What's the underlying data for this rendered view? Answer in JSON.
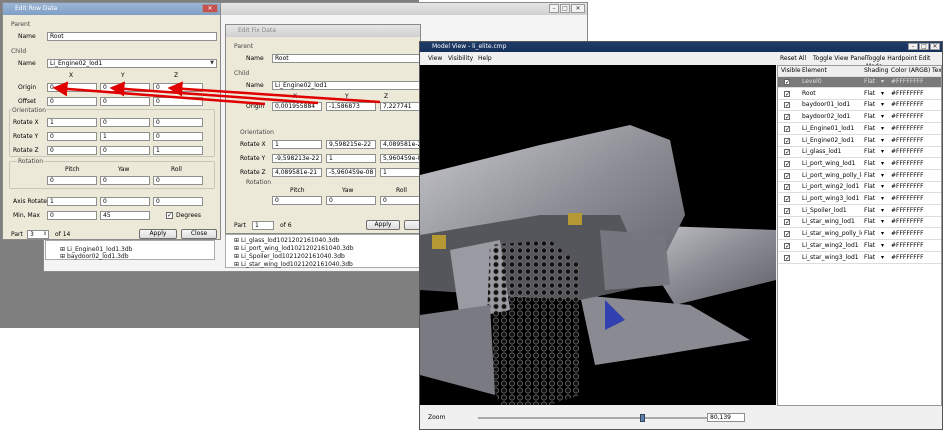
{
  "edit_row_dialog": {
    "title": "Edit Row Data",
    "parent_section": "Parent",
    "parent_name_label": "Name",
    "parent_name_value": "Root",
    "child_section": "Child",
    "child_name_label": "Name",
    "child_name_value": "Li_Engine02_lod1",
    "col_x": "X",
    "col_y": "Y",
    "col_z": "Z",
    "origin_label": "Origin",
    "origin": [
      "0",
      "0",
      "0"
    ],
    "offset_label": "Offset",
    "offset": [
      "0",
      "0",
      "0"
    ],
    "orientation_section": "Orientation",
    "rotate_x_label": "Rotate X",
    "rotate_x": [
      "1",
      "0",
      "0"
    ],
    "rotate_y_label": "Rotate Y",
    "rotate_y": [
      "0",
      "1",
      "0"
    ],
    "rotate_z_label": "Rotate Z",
    "rotate_z": [
      "0",
      "0",
      "1"
    ],
    "rotation_section": "Rotation",
    "pitch_label": "Pitch",
    "yaw_label": "Yaw",
    "roll_label": "Roll",
    "rotation": [
      "0",
      "0",
      "0"
    ],
    "axis_rotate_label": "Axis Rotate",
    "axis_rotate": [
      "1",
      "0",
      "0"
    ],
    "min_max_label": "Min, Max",
    "min_max": [
      "0",
      "45"
    ],
    "degrees_label": "Degrees",
    "part_label": "Part",
    "part_value": "3",
    "part_of": "of 14",
    "apply_label": "Apply",
    "close_label": "Close"
  },
  "fix_dialog": {
    "title": "Edit Fix Data",
    "parent_section": "Parent",
    "parent_name_label": "Name",
    "parent_name_value": "Root",
    "child_section": "Child",
    "child_name_label": "Name",
    "child_name_value": "Li_Engine02_lod1",
    "col_x": "X",
    "col_y": "Y",
    "col_z": "Z",
    "origin_label": "Origin",
    "origin": [
      "0,001955884",
      "-1,586873",
      "7,227741"
    ],
    "orientation_section": "Orientation",
    "rotate_x_label": "Rotate X",
    "rotate_x": [
      "1",
      "9,598215e-22",
      "4,089581e-21"
    ],
    "rotate_y_label": "Rotate Y",
    "rotate_y": [
      "-9,598213e-22",
      "1",
      "5,960459e-08"
    ],
    "rotate_z_label": "Rotate Z",
    "rotate_z": [
      "4,089581e-21",
      "-5,960459e-08",
      "1"
    ],
    "rotation_section": "Rotation",
    "pitch_label": "Pitch",
    "yaw_label": "Yaw",
    "roll_label": "Roll",
    "rotation": [
      "0",
      "0",
      "0"
    ],
    "part_label": "Part",
    "part_value": "1",
    "part_of": "of 6",
    "apply_label": "Apply"
  },
  "back_tree": {
    "left_items": [
      "Li_Engine01_lod1.3db",
      "baydoor02_lod1.3db"
    ],
    "right_items": [
      "Li_glass_lod1021202161040.3db",
      "Li_port_wing_lod1021202161040.3db",
      "Li_Spoiler_lod1021202161040.3db",
      "Li_star_wing_lod1021202161040.3db"
    ]
  },
  "model_view": {
    "title": "Model View - li_elite.cmp",
    "menu": [
      "View",
      "Visibility",
      "Help"
    ],
    "toolbar": [
      "Reset All",
      "Toggle View Panel",
      "Toggle Hardpoint Edit Mode"
    ],
    "columns": [
      "Visible",
      "Element",
      "Shading",
      "Color (ARGB)",
      "Tex"
    ],
    "rows": [
      {
        "element": "Level0",
        "shading": "Flat",
        "color": "#FFFFFFFF",
        "checked": true,
        "selected": true
      },
      {
        "element": "Root",
        "shading": "Flat",
        "color": "#FFFFFFFF",
        "checked": true
      },
      {
        "element": "baydoor01_lod1",
        "shading": "Flat",
        "color": "#FFFFFFFF",
        "checked": true
      },
      {
        "element": "baydoor02_lod1",
        "shading": "Flat",
        "color": "#FFFFFFFF",
        "checked": true
      },
      {
        "element": "Li_Engine01_lod1",
        "shading": "Flat",
        "color": "#FFFFFFFF",
        "checked": true
      },
      {
        "element": "Li_Engine02_lod1",
        "shading": "Flat",
        "color": "#FFFFFFFF",
        "checked": true
      },
      {
        "element": "Li_glass_lod1",
        "shading": "Flat",
        "color": "#FFFFFFFF",
        "checked": true
      },
      {
        "element": "Li_port_wing_lod1",
        "shading": "Flat",
        "color": "#FFFFFFFF",
        "checked": true
      },
      {
        "element": "Li_port_wing_polly_lod1",
        "shading": "Flat",
        "color": "#FFFFFFFF",
        "checked": true
      },
      {
        "element": "Li_port_wing2_lod1",
        "shading": "Flat",
        "color": "#FFFFFFFF",
        "checked": true
      },
      {
        "element": "Li_port_wing3_lod1",
        "shading": "Flat",
        "color": "#FFFFFFFF",
        "checked": true
      },
      {
        "element": "Li_Spoiler_lod1",
        "shading": "Flat",
        "color": "#FFFFFFFF",
        "checked": true
      },
      {
        "element": "Li_star_wing_lod1",
        "shading": "Flat",
        "color": "#FFFFFFFF",
        "checked": true
      },
      {
        "element": "Li_star_wing_polly_lod1",
        "shading": "Flat",
        "color": "#FFFFFFFF",
        "checked": true
      },
      {
        "element": "Li_star_wing2_lod1",
        "shading": "Flat",
        "color": "#FFFFFFFF",
        "checked": true
      },
      {
        "element": "Li_star_wing3_lod1",
        "shading": "Flat",
        "color": "#FFFFFFFF",
        "checked": true
      }
    ],
    "zoom_label": "Zoom",
    "zoom_value": "80,139",
    "zoom_fraction": 0.72
  },
  "colors": {
    "arrow": "#e00000",
    "title_active": "#16305a"
  }
}
